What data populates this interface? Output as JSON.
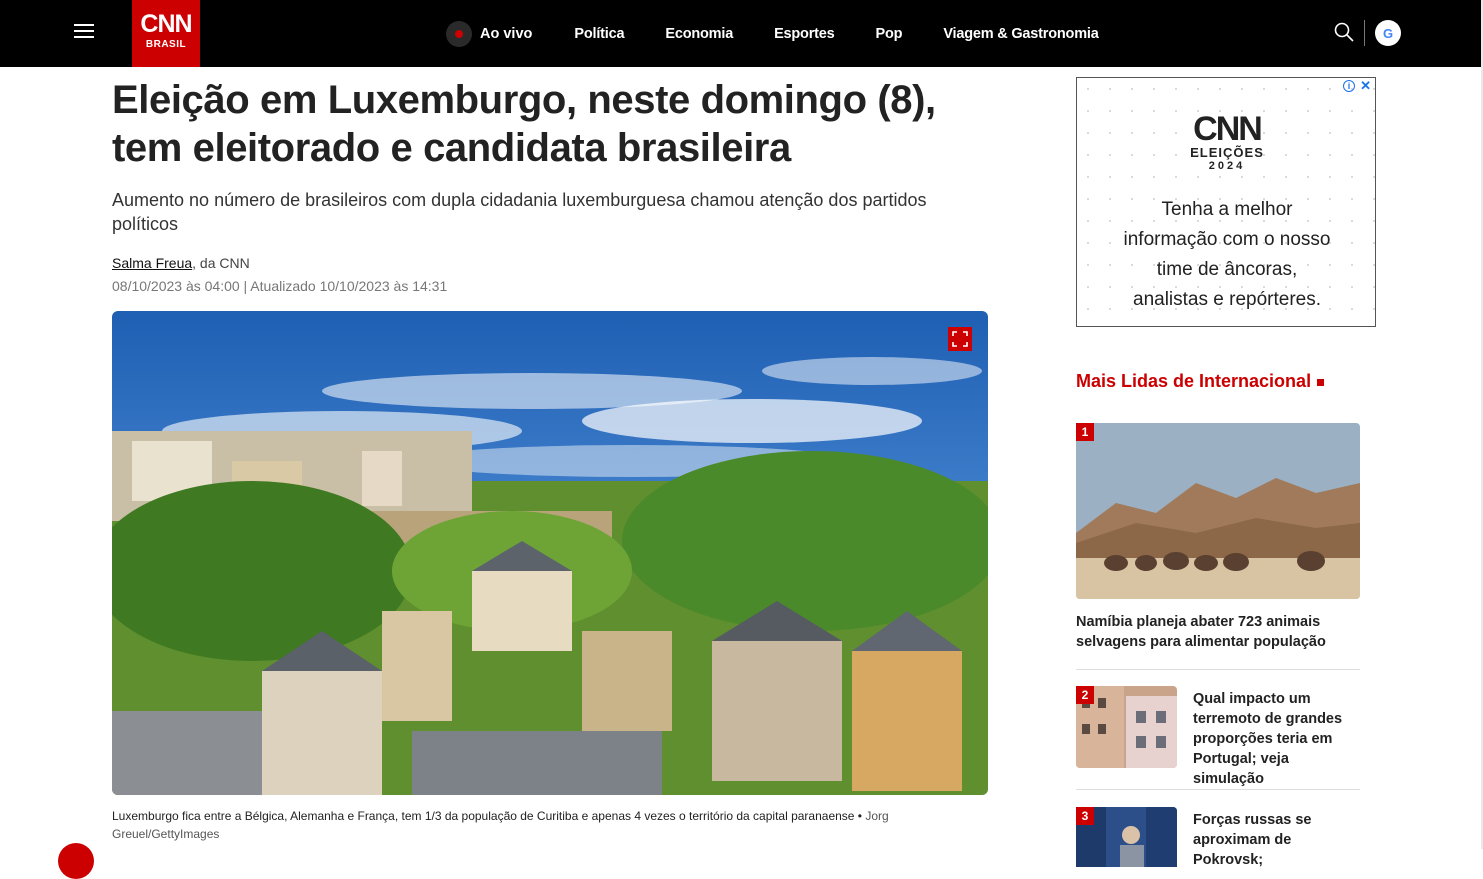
{
  "header": {
    "logo_text": "CNN",
    "logo_sub": "BRASIL",
    "live_label": "Ao vivo",
    "nav_items": [
      "Política",
      "Economia",
      "Esportes",
      "Pop",
      "Viagem & Gastronomia"
    ],
    "google_label": "G"
  },
  "article": {
    "headline": "Eleição em Luxemburgo, neste domingo (8), tem eleitorado e candidata brasileira",
    "subhead": "Aumento no número de brasileiros com dupla cidadania luxemburguesa chamou atenção dos partidos políticos",
    "author": "Salma Freua",
    "author_suffix": ", da CNN",
    "dateline": "08/10/2023 às 04:00 | Atualizado 10/10/2023 às 14:31",
    "caption": "Luxemburgo fica entre a Bélgica, Alemanha e França, tem 1/3 da população de Curitiba e apenas 4 vezes o território da capital paranaense",
    "caption_sep": " • ",
    "credit": "Jorg Greuel/GettyImages"
  },
  "ad": {
    "info": "i",
    "close": "✕",
    "logo_cnn": "CNN",
    "logo_eleicoes": "ELEIÇÕES",
    "logo_year": "2024",
    "text_lines": [
      "Tenha a melhor",
      "informação com o nosso",
      "time de âncoras,",
      "analistas e repórteres."
    ]
  },
  "mais_lidas": {
    "title": "Mais Lidas de Internacional",
    "items": [
      {
        "rank": "1",
        "title": "Namíbia planeja abater 723 animais selvagens para alimentar população"
      },
      {
        "rank": "2",
        "title": "Qual impacto um terremoto de grandes proporções teria em Portugal; veja simulação"
      },
      {
        "rank": "3",
        "title": "Forças russas se aproximam de Pokrovsk;"
      }
    ]
  },
  "colors": {
    "brand_red": "#cc0000",
    "nav_bg": "#000000"
  }
}
